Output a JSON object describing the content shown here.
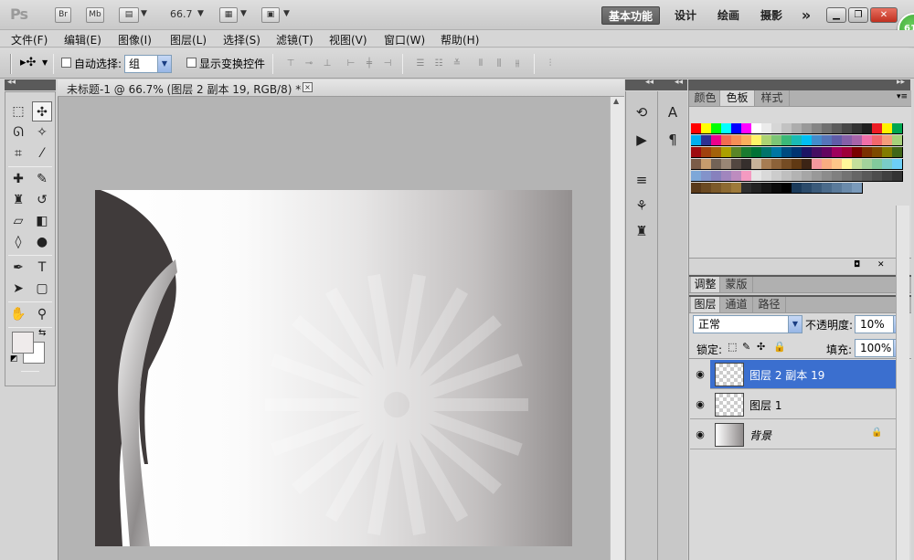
{
  "app": {
    "logo": "Ps"
  },
  "appbar": {
    "bridge": "Br",
    "minibridge": "Mb",
    "zoom": "66.7",
    "workspaces": [
      "基本功能",
      "设计",
      "绘画",
      "摄影"
    ],
    "more": "»",
    "badge": "61"
  },
  "menu": [
    "文件(F)",
    "编辑(E)",
    "图像(I)",
    "图层(L)",
    "选择(S)",
    "滤镜(T)",
    "视图(V)",
    "窗口(W)",
    "帮助(H)"
  ],
  "options": {
    "auto_select_label": "自动选择:",
    "auto_select_value": "组",
    "show_transform_label": "显示变换控件"
  },
  "document": {
    "tab_title": "未标题-1 @ 66.7% (图层 2 副本 19, RGB/8) *",
    "close": "×"
  },
  "panels": {
    "top_tabs": [
      "颜色",
      "色板",
      "样式"
    ],
    "mid_tabs": [
      "调整",
      "蒙版"
    ],
    "layers_tabs": [
      "图层",
      "通道",
      "路径"
    ],
    "blend_mode": "正常",
    "opacity_label": "不透明度:",
    "opacity_value": "10%",
    "lock_label": "锁定:",
    "fill_label": "填充:",
    "fill_value": "100%",
    "layers": [
      {
        "name": "图层 2 副本 19",
        "active": true
      },
      {
        "name": "图层 1",
        "active": false
      },
      {
        "name": "背景",
        "active": false
      }
    ]
  },
  "colors": {
    "swatch_rows": [
      [
        "#ff0000",
        "#ffff00",
        "#00ff00",
        "#00ffff",
        "#0000ff",
        "#ff00ff",
        "#ffffff",
        "#ebebeb",
        "#d6d6d6",
        "#c2c2c2",
        "#adadad",
        "#999999",
        "#858585",
        "#707070",
        "#5c5c5c",
        "#474747",
        "#333333",
        "#1f1f1f",
        "#ec1c24",
        "#fff200",
        "#00a650"
      ],
      [
        "#00aeef",
        "#2e3192",
        "#ec008c",
        "#f26c4f",
        "#f68e55",
        "#fbaf5c",
        "#fff467",
        "#acd372",
        "#7cc576",
        "#3bb878",
        "#1abbb4",
        "#00bff3",
        "#438ccb",
        "#5574b9",
        "#605ca8",
        "#855fa8",
        "#a763a9",
        "#f06ea9",
        "#f2676c",
        "#f49d7a",
        "#a6d17a"
      ],
      [
        "#9e0b0f",
        "#a0410d",
        "#a3620a",
        "#aba000",
        "#598527",
        "#1a7b30",
        "#007236",
        "#00746b",
        "#0076a3",
        "#004b80",
        "#003471",
        "#1b1464",
        "#440e62",
        "#630460",
        "#9e005d",
        "#9e0039",
        "#790000",
        "#7b2e00",
        "#7d4900",
        "#827b00",
        "#406618"
      ],
      [
        "#7b5c48",
        "#c69c6d",
        "#736357",
        "#998675",
        "#534741",
        "#362f2d",
        "#c7b299",
        "#a67c52",
        "#8c6239",
        "#754c24",
        "#603913",
        "#3c2415",
        "#f5989d",
        "#f9ad81",
        "#fdc689",
        "#fff799",
        "#c4df9b",
        "#a3d39c",
        "#82ca9c",
        "#7accc8",
        "#6dcff6"
      ],
      [
        "#7ea7d8",
        "#8393ca",
        "#8781bd",
        "#a186be",
        "#bd8cbf",
        "#f49ac1",
        "#e6e6e6",
        "#d9d9d9",
        "#cccccc",
        "#bfbfbf",
        "#b3b3b3",
        "#a6a6a6",
        "#999999",
        "#8c8c8c",
        "#808080",
        "#737373",
        "#666666",
        "#595959",
        "#4d4d4d",
        "#404040",
        "#333333"
      ],
      [
        "#5a3a1a",
        "#6b4a22",
        "#7c5a2a",
        "#8d6a32",
        "#9e7a3a",
        "#2e2e2e",
        "#222222",
        "#161616",
        "#0a0a0a",
        "#000000",
        "#1a3a5a",
        "#2a4a6a",
        "#3a5a7a",
        "#4a6a8a",
        "#5a7a9a",
        "#6a8aaa",
        "#7a9aba"
      ]
    ]
  }
}
